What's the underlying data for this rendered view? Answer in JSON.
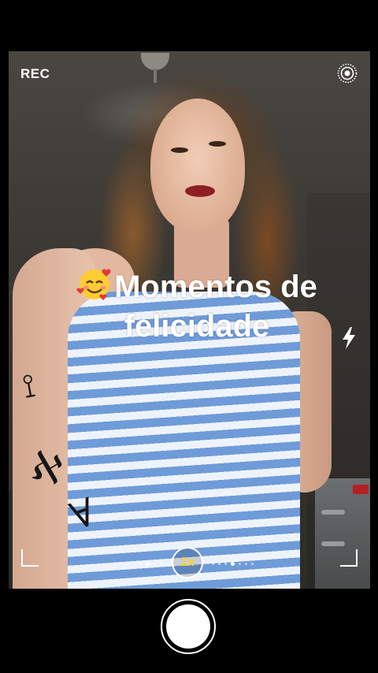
{
  "status": {
    "rec_label": "REC"
  },
  "caption": {
    "emoji_name": "smiling-face-with-hearts",
    "line1": "Momentos de",
    "line2": "felicidade"
  },
  "zoom": {
    "label": "1x"
  },
  "icons": {
    "settings": "live-photo-icon",
    "flash": "flash-icon"
  },
  "colors": {
    "zoom_text": "#ffd21f",
    "dress_stripe_blue": "#6f9bd8",
    "lipstick": "#8e1f24"
  }
}
